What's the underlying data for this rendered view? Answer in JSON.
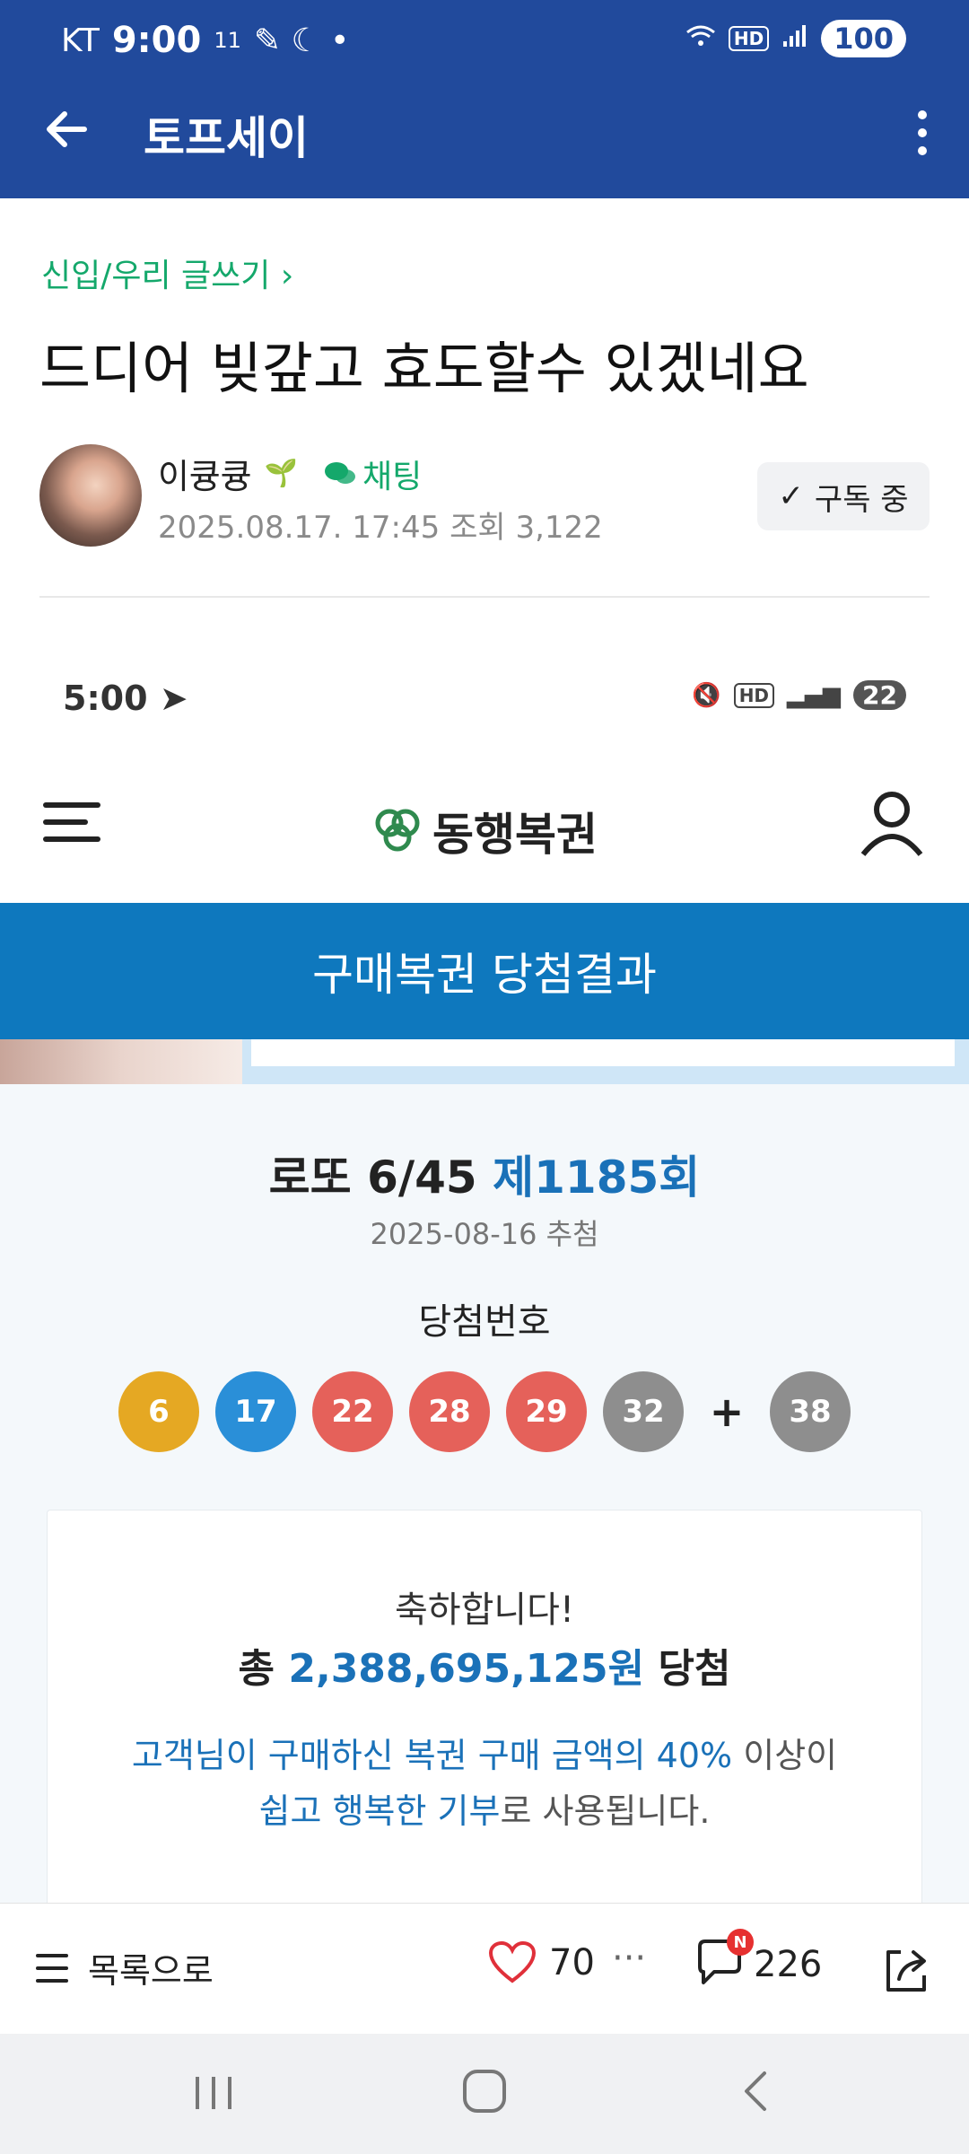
{
  "status_bar": {
    "carrier": "KT",
    "time": "9:00",
    "left_extra": "11",
    "battery": "100",
    "hd": "HD"
  },
  "app_bar": {
    "title": "토프세이"
  },
  "post": {
    "category": "신입/우리 글쓰기 ›",
    "title": "드디어 빚갚고 효도할수 있겠네요",
    "author": "이큥큥",
    "chat_label": "채팅",
    "date": "2025.08.17. 17:45",
    "views": "조회 3,122",
    "subscribe_label": "구독 중"
  },
  "embedded": {
    "status_time": "5:00",
    "status_battery": "22",
    "status_hd": "HD",
    "site_name": "동행복권",
    "page_title": "구매복권 당첨결과",
    "draw_name": "로또 6/45",
    "draw_round": "제1185회",
    "draw_date": "2025-08-16 추첨",
    "winning_label": "당첨번호",
    "numbers": [
      "6",
      "17",
      "22",
      "28",
      "29",
      "32"
    ],
    "number_colors": [
      "#e5a823",
      "#2a8fd8",
      "#e5615a",
      "#e5615a",
      "#e5615a",
      "#8e8e8e"
    ],
    "plus": "+",
    "bonus": "38",
    "bonus_color": "#8e8e8e",
    "congrats": "축하합니다!",
    "total_prefix": "총",
    "total_amount": "2,388,695,125원",
    "total_suffix": "당첨",
    "donate_line1_blue": "고객님이 구매하신 복권 구매 금액의 40%",
    "donate_line1_rest": "이상이",
    "donate_line2_blue": "쉽고 행복한 기부",
    "donate_line2_rest": "로 사용됩니다."
  },
  "action_bar": {
    "list_label": "목록으로",
    "likes": "70",
    "more": "···",
    "comment_badge": "N",
    "comments": "226"
  },
  "icons": {
    "back": "arrow-left-icon",
    "more": "more-vertical-icon",
    "heart": "heart-icon",
    "comment": "comment-icon",
    "share": "share-icon"
  },
  "colors": {
    "app_bar": "#214a9c",
    "accent_green": "#14a86b",
    "lottery_blue": "#0e78be"
  }
}
